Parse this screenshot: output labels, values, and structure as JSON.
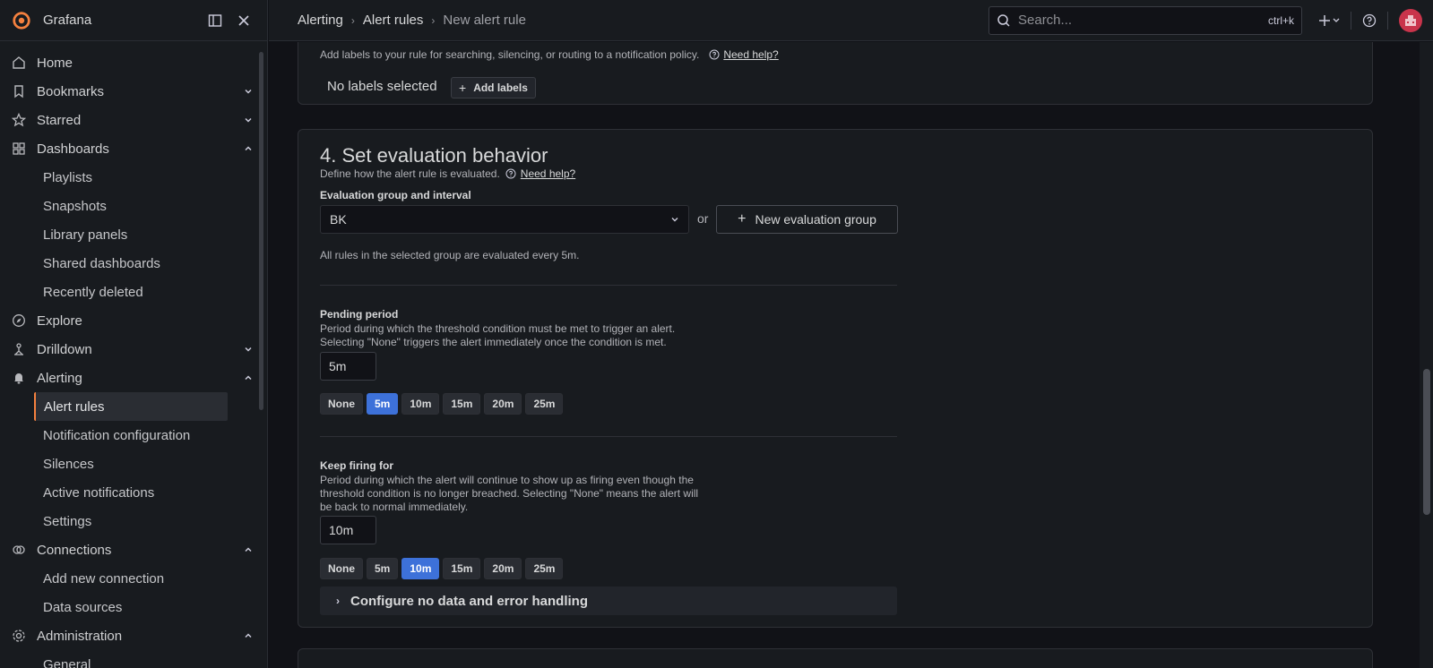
{
  "app": {
    "name": "Grafana"
  },
  "breadcrumbs": [
    "Alerting",
    "Alert rules",
    "New alert rule"
  ],
  "search": {
    "placeholder": "Search...",
    "shortcut": "ctrl+k"
  },
  "sidebar": {
    "items": [
      {
        "label": "Home",
        "icon": "home-icon",
        "chevron": ""
      },
      {
        "label": "Bookmarks",
        "icon": "bookmark-icon",
        "chevron": "down"
      },
      {
        "label": "Starred",
        "icon": "star-icon",
        "chevron": "down"
      },
      {
        "label": "Dashboards",
        "icon": "apps-icon",
        "chevron": "up"
      }
    ],
    "dashboards_sub": [
      "Playlists",
      "Snapshots",
      "Library panels",
      "Shared dashboards",
      "Recently deleted"
    ],
    "explore": "Explore",
    "drilldown": "Drilldown",
    "alerting": "Alerting",
    "alerting_sub": [
      "Alert rules",
      "Notification configuration",
      "Silences",
      "Active notifications",
      "Settings"
    ],
    "connections": "Connections",
    "connections_sub": [
      "Add new connection",
      "Data sources"
    ],
    "administration": "Administration",
    "administration_sub": [
      "General"
    ]
  },
  "labels_section": {
    "help_text": "Add labels to your rule for searching, silencing, or routing to a notification policy.",
    "help_link": "Need help?",
    "empty_text": "No labels selected",
    "add_button": "Add labels"
  },
  "evaluation": {
    "title": "4. Set evaluation behavior",
    "description": "Define how the alert rule is evaluated.",
    "help_link": "Need help?",
    "group_label": "Evaluation group and interval",
    "group_value": "BK",
    "or_text": "or",
    "new_group_button": "New evaluation group",
    "group_note": "All rules in the selected group are evaluated every 5m.",
    "pending": {
      "label": "Pending period",
      "desc1": "Period during which the threshold condition must be met to trigger an alert.",
      "desc2": "Selecting \"None\" triggers the alert immediately once the condition is met.",
      "value": "5m",
      "options": [
        "None",
        "5m",
        "10m",
        "15m",
        "20m",
        "25m"
      ],
      "selected": "5m"
    },
    "keep_firing": {
      "label": "Keep firing for",
      "desc1": "Period during which the alert will continue to show up as firing even though the",
      "desc2": "threshold condition is no longer breached. Selecting \"None\" means the alert will",
      "desc3": "be back to normal immediately.",
      "value": "10m",
      "options": [
        "None",
        "5m",
        "10m",
        "15m",
        "20m",
        "25m"
      ],
      "selected": "10m"
    },
    "no_data_toggle": "Configure no data and error handling"
  },
  "colors": {
    "accent": "#3d71d9",
    "active_marker": "#f5813f",
    "avatar": "#c9344b",
    "logo": "#f5813f"
  }
}
